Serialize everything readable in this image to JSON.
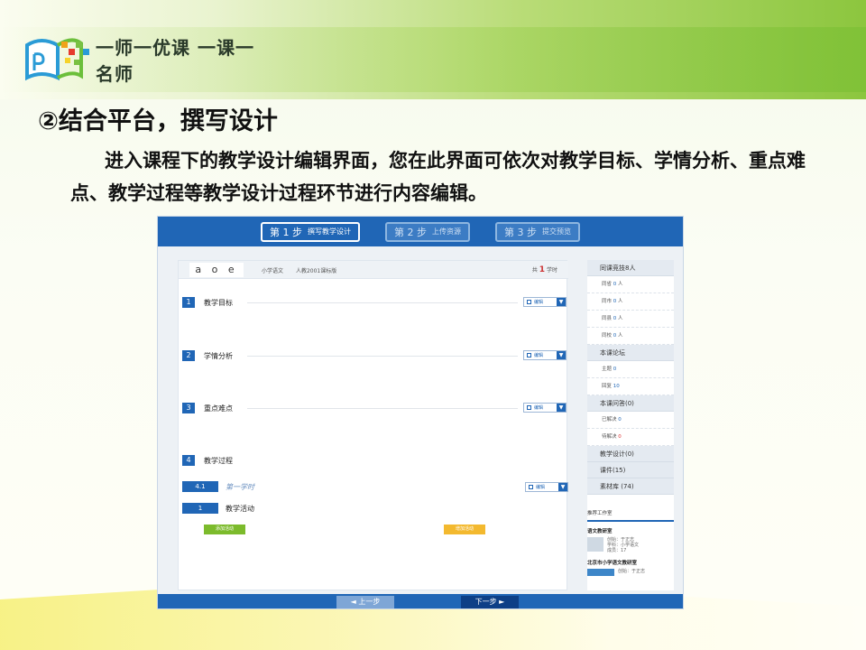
{
  "logo": {
    "slogan": "一师一优课 一课一名师"
  },
  "heading": "②结合平台，撰写设计",
  "paragraph": "进入课程下的教学设计编辑界面，您在此界面可依次对教学目标、学情分析、重点难点、教学过程等教学设计过程环节进行内容编辑。",
  "colors": {
    "brand_blue": "#2066b6",
    "accent_green": "#7cbb2c",
    "accent_yellow": "#f3b92f"
  },
  "steps": [
    {
      "no": "第 1 步",
      "label": "撰写教学设计"
    },
    {
      "no": "第 2 步",
      "label": "上传资源"
    },
    {
      "no": "第 3 步",
      "label": "提交预览"
    }
  ],
  "course": {
    "name": "a o e",
    "subject": "小学语文",
    "edition": "人教2001课标版",
    "hours_prefix": "共",
    "hours_value": "1",
    "hours_suffix": "学时"
  },
  "sections": [
    {
      "no": "1",
      "title": "教学目标"
    },
    {
      "no": "2",
      "title": "学情分析"
    },
    {
      "no": "3",
      "title": "重点难点"
    },
    {
      "no": "4",
      "title": "教学过程"
    }
  ],
  "edit_label": "编辑",
  "subsection": {
    "no": "4.1",
    "title": "第一学时"
  },
  "activity": {
    "no": "1",
    "title": "教学活动"
  },
  "add_activity_label": "添加活动",
  "add_other_label": "增加活动",
  "sidebar": {
    "competition_title": "同课竞技8人",
    "competition_rows": [
      {
        "label": "同省",
        "value": "0",
        "unit": "人"
      },
      {
        "label": "同市",
        "value": "0",
        "unit": "人"
      },
      {
        "label": "同县",
        "value": "0",
        "unit": "人"
      },
      {
        "label": "同校",
        "value": "0",
        "unit": "人"
      }
    ],
    "forum_title": "本课论坛",
    "forum_rows": [
      {
        "label": "主题",
        "value": "0"
      },
      {
        "label": "回复",
        "value": "10"
      }
    ],
    "qa_title": "本课问答(0)",
    "qa_rows": [
      {
        "label": "已解决",
        "value": "0"
      },
      {
        "label": "待解决",
        "value": "0"
      }
    ],
    "design_title": "教学设计(0)",
    "courseware_title": "课件(15)",
    "materials_title": "素材库 (74)",
    "workroom_title": "推荐工作室",
    "workroom1": {
      "name": "语文教研室",
      "founder": "创始：于正志",
      "subject": "学科：小学语文",
      "members": "成员：17"
    },
    "workroom2": {
      "name": "北京市小学语文教研室",
      "founder": "创始：于正志"
    }
  },
  "nav": {
    "prev": "◄ 上一步",
    "next": "下一步 ►"
  }
}
